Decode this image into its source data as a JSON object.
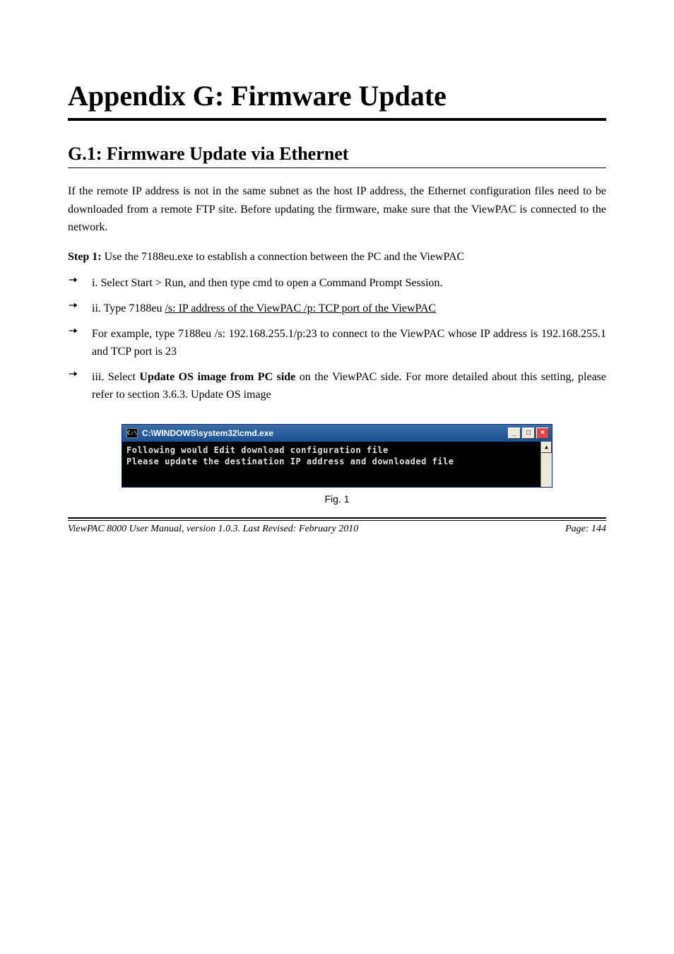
{
  "chapter": {
    "title": "Appendix G: Firmware Update"
  },
  "sections": [
    {
      "title": "G.1: Firmware Update via Ethernet",
      "intro": "If the remote IP address is not in the same subnet as the host IP address, the Ethernet configuration files need to be downloaded from a remote FTP site. Before updating the firmware, make sure that the ViewPAC is connected to the network.",
      "step_label": "Step 1:",
      "step_text": "Use the 7188eu.exe to establish a connection between the PC and the ViewPAC",
      "bullets": [
        {
          "text": "i. Select Start > Run, and then type cmd to open a Command Prompt Session."
        },
        {
          "text_prefix": "ii. Type 7188eu /s: IP address of the ViewPAC /p: TCP port of the ViewPAC",
          "underline_segment": "",
          "text_middle_underline": "/s: IP address of the ViewPAC /p: TCP port of the ViewPAC",
          "text_plain": "ii. Type 7188eu ",
          "text_after": ""
        },
        {
          "text": "For example, type 7188eu /s: 192.168.255.1/p:23 to connect to the ViewPAC whose IP address is 192.168.255.1 and TCP port is 23"
        },
        {
          "text_bold_prefix": "iii. Select",
          "text_bold": "Update OS image from PC side",
          "text_suffix": " on the ViewPAC side. For more detailed about this setting, please refer to section 3.6.3. Update OS image"
        }
      ]
    }
  ],
  "cmd": {
    "title": "C:\\WINDOWS\\system32\\cmd.exe",
    "icon_label": "C:\\",
    "line1": "Following would Edit download configuration file",
    "line2": "Please update the destination IP address and downloaded file",
    "btn_min": "_",
    "btn_max": "□",
    "btn_close": "×",
    "scroll_up": "▲"
  },
  "figure_caption": "Fig. 1",
  "footer": {
    "left": "ViewPAC 8000 User Manual, version 1.0.3.  Last Revised: February 2010",
    "right": "Page: 144"
  }
}
